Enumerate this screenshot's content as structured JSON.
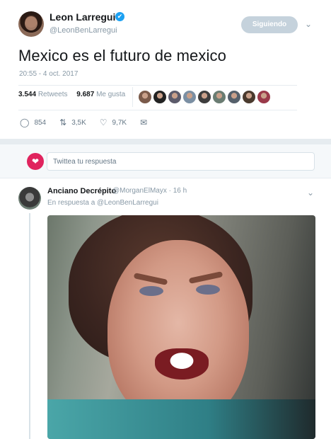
{
  "main_tweet": {
    "author_name": "Leon Larregui",
    "verified_icon": "✔",
    "handle": "@LeonBenLarregui",
    "follow_label": "Siguiendo",
    "text": "Mexico es el futuro de mexico",
    "timestamp": "20:55 - 4 oct. 2017",
    "retweets_count": "3.544",
    "retweets_label": "Retweets",
    "likes_count": "9.687",
    "likes_label": "Me gusta",
    "liker_avatar_colors": [
      "#7a5a4a",
      "#222222",
      "#5c5b6b",
      "#7b8fa3",
      "#3d3d3d",
      "#6a7c72",
      "#55606b",
      "#4a3a2e",
      "#9a3a4a"
    ],
    "actions": {
      "reply_count": "854",
      "retweet_count": "3,5K",
      "like_count": "9,7K"
    }
  },
  "reply_composer": {
    "placeholder": "Twittea tu respuesta"
  },
  "reply_tweet": {
    "author_name": "Anciano Decrépito",
    "meta": "@MorganElMayx · 16 h",
    "in_reply_prefix": "En respuesta a",
    "in_reply_handle": "@LeonBenLarregui"
  },
  "colors": {
    "accent": "#1da1f2",
    "muted": "#8899a6",
    "follow_button": "#c5d2dc"
  }
}
